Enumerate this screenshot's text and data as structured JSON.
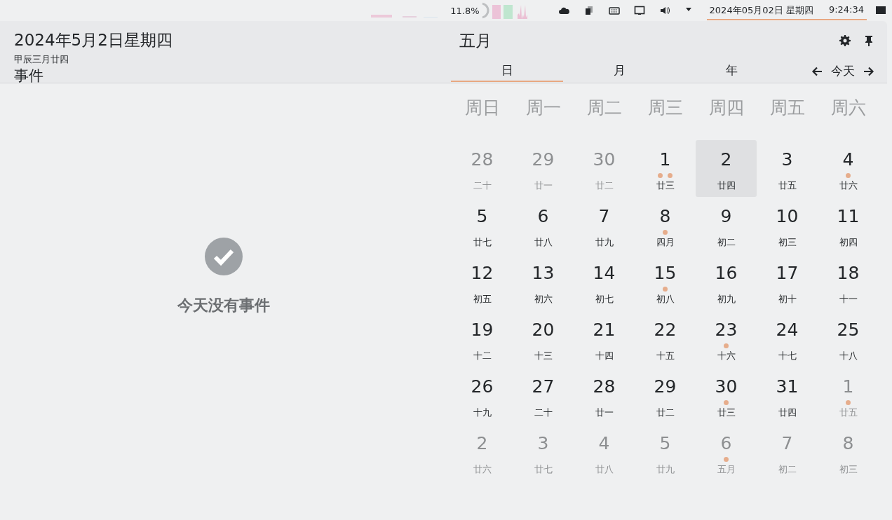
{
  "panel": {
    "cpu_reading": "11.8%",
    "clock": {
      "date": "2024年05月02日 星期四",
      "time": "9:24:34",
      "active": true
    }
  },
  "agenda": {
    "date_title": "2024年5月2日星期四",
    "lunar_date": "甲辰三月廿四",
    "section_title": "事件",
    "empty_message": "今天没有事件"
  },
  "calendar": {
    "month_title": "五月",
    "tabs": [
      {
        "label": "日",
        "selected": true
      },
      {
        "label": "月",
        "selected": false
      },
      {
        "label": "年",
        "selected": false
      }
    ],
    "today_button": "今天",
    "weekdays": [
      "周日",
      "周一",
      "周二",
      "周三",
      "周四",
      "周五",
      "周六"
    ],
    "weeks": [
      [
        {
          "day": "28",
          "lunar": "二十",
          "other_month": true,
          "selected": false
        },
        {
          "day": "29",
          "lunar": "廿一",
          "other_month": true,
          "selected": false
        },
        {
          "day": "30",
          "lunar": "廿二",
          "other_month": true,
          "selected": false
        },
        {
          "day": "1",
          "lunar": "廿三",
          "other_month": false,
          "selected": false,
          "events": [
            {
              "kind": "dot"
            },
            {
              "kind": "dot"
            }
          ]
        },
        {
          "day": "2",
          "lunar": "廿四",
          "other_month": false,
          "selected": true
        },
        {
          "day": "3",
          "lunar": "廿五",
          "other_month": false,
          "selected": false
        },
        {
          "day": "4",
          "lunar": "廿六",
          "other_month": false,
          "selected": false,
          "events": [
            {
              "kind": "dot"
            }
          ]
        }
      ],
      [
        {
          "day": "5",
          "lunar": "廿七",
          "other_month": false,
          "selected": false
        },
        {
          "day": "6",
          "lunar": "廿八",
          "other_month": false,
          "selected": false
        },
        {
          "day": "7",
          "lunar": "廿九",
          "other_month": false,
          "selected": false
        },
        {
          "day": "8",
          "lunar": "四月",
          "other_month": false,
          "selected": false,
          "events": [
            {
              "kind": "dot"
            }
          ]
        },
        {
          "day": "9",
          "lunar": "初二",
          "other_month": false,
          "selected": false
        },
        {
          "day": "10",
          "lunar": "初三",
          "other_month": false,
          "selected": false
        },
        {
          "day": "11",
          "lunar": "初四",
          "other_month": false,
          "selected": false
        }
      ],
      [
        {
          "day": "12",
          "lunar": "初五",
          "other_month": false,
          "selected": false
        },
        {
          "day": "13",
          "lunar": "初六",
          "other_month": false,
          "selected": false
        },
        {
          "day": "14",
          "lunar": "初七",
          "other_month": false,
          "selected": false
        },
        {
          "day": "15",
          "lunar": "初八",
          "other_month": false,
          "selected": false,
          "events": [
            {
              "kind": "dot"
            }
          ]
        },
        {
          "day": "16",
          "lunar": "初九",
          "other_month": false,
          "selected": false
        },
        {
          "day": "17",
          "lunar": "初十",
          "other_month": false,
          "selected": false
        },
        {
          "day": "18",
          "lunar": "十一",
          "other_month": false,
          "selected": false
        }
      ],
      [
        {
          "day": "19",
          "lunar": "十二",
          "other_month": false,
          "selected": false
        },
        {
          "day": "20",
          "lunar": "十三",
          "other_month": false,
          "selected": false
        },
        {
          "day": "21",
          "lunar": "十四",
          "other_month": false,
          "selected": false
        },
        {
          "day": "22",
          "lunar": "十五",
          "other_month": false,
          "selected": false
        },
        {
          "day": "23",
          "lunar": "十六",
          "other_month": false,
          "selected": false,
          "events": [
            {
              "kind": "dot"
            }
          ]
        },
        {
          "day": "24",
          "lunar": "十七",
          "other_month": false,
          "selected": false
        },
        {
          "day": "25",
          "lunar": "十八",
          "other_month": false,
          "selected": false
        }
      ],
      [
        {
          "day": "26",
          "lunar": "十九",
          "other_month": false,
          "selected": false
        },
        {
          "day": "27",
          "lunar": "二十",
          "other_month": false,
          "selected": false
        },
        {
          "day": "28",
          "lunar": "廿一",
          "other_month": false,
          "selected": false
        },
        {
          "day": "29",
          "lunar": "廿二",
          "other_month": false,
          "selected": false
        },
        {
          "day": "30",
          "lunar": "廿三",
          "other_month": false,
          "selected": false,
          "events": [
            {
              "kind": "dot"
            }
          ]
        },
        {
          "day": "31",
          "lunar": "廿四",
          "other_month": false,
          "selected": false
        },
        {
          "day": "1",
          "lunar": "廿五",
          "other_month": true,
          "selected": false,
          "events": [
            {
              "kind": "dot"
            }
          ]
        }
      ],
      [
        {
          "day": "2",
          "lunar": "廿六",
          "other_month": true,
          "selected": false
        },
        {
          "day": "3",
          "lunar": "廿七",
          "other_month": true,
          "selected": false
        },
        {
          "day": "4",
          "lunar": "廿八",
          "other_month": true,
          "selected": false
        },
        {
          "day": "5",
          "lunar": "廿九",
          "other_month": true,
          "selected": false
        },
        {
          "day": "6",
          "lunar": "五月",
          "other_month": true,
          "selected": false,
          "events": [
            {
              "kind": "dot"
            }
          ]
        },
        {
          "day": "7",
          "lunar": "初二",
          "other_month": true,
          "selected": false
        },
        {
          "day": "8",
          "lunar": "初三",
          "other_month": true,
          "selected": false
        }
      ]
    ]
  }
}
